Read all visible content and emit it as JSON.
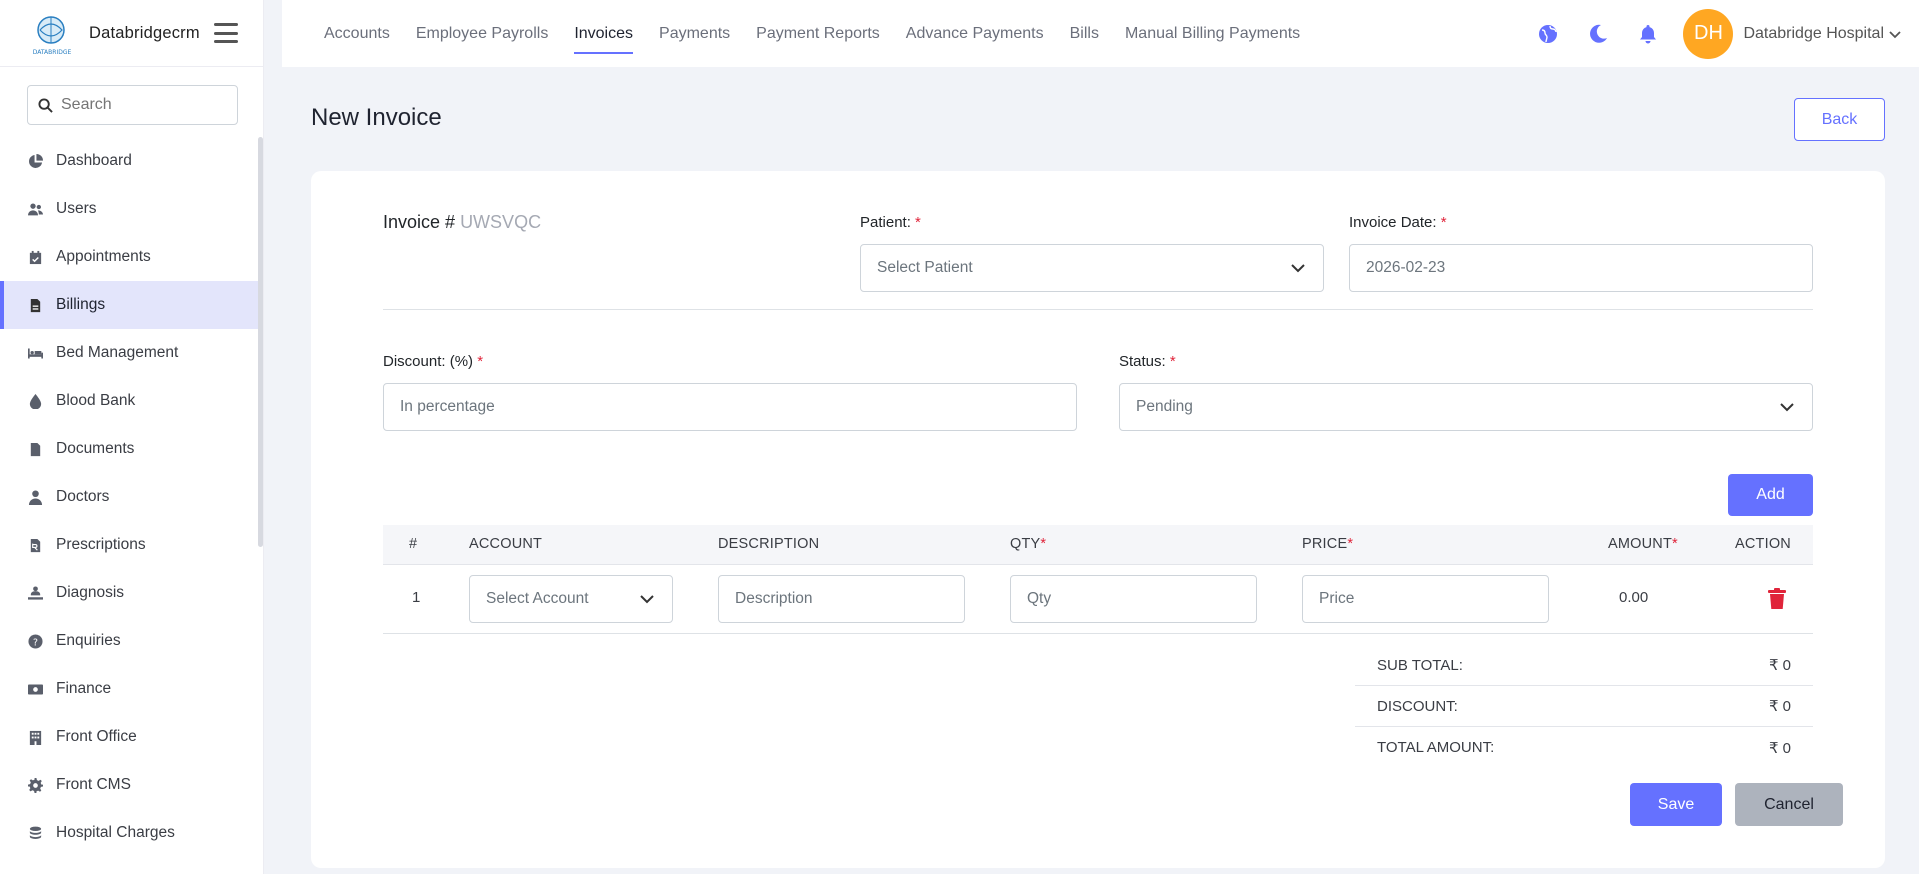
{
  "brand": {
    "name": "Databridgecrm",
    "logo_text": "DATABRIDGE"
  },
  "search": {
    "placeholder": "Search"
  },
  "sidebar": {
    "items": [
      {
        "label": "Dashboard",
        "icon": "pie-chart-icon"
      },
      {
        "label": "Users",
        "icon": "users-icon"
      },
      {
        "label": "Appointments",
        "icon": "calendar-check-icon"
      },
      {
        "label": "Billings",
        "icon": "file-invoice-icon",
        "active": true
      },
      {
        "label": "Bed Management",
        "icon": "bed-icon"
      },
      {
        "label": "Blood Bank",
        "icon": "drop-icon"
      },
      {
        "label": "Documents",
        "icon": "file-icon"
      },
      {
        "label": "Doctors",
        "icon": "doctor-icon"
      },
      {
        "label": "Prescriptions",
        "icon": "prescription-icon"
      },
      {
        "label": "Diagnosis",
        "icon": "diagnosis-icon"
      },
      {
        "label": "Enquiries",
        "icon": "question-circle-icon"
      },
      {
        "label": "Finance",
        "icon": "money-icon"
      },
      {
        "label": "Front Office",
        "icon": "building-icon"
      },
      {
        "label": "Front CMS",
        "icon": "gear-icon"
      },
      {
        "label": "Hospital Charges",
        "icon": "coins-icon"
      }
    ]
  },
  "topnav": {
    "tabs": [
      "Accounts",
      "Employee Payrolls",
      "Invoices",
      "Payments",
      "Payment Reports",
      "Advance Payments",
      "Bills",
      "Manual Billing Payments"
    ],
    "active_tab": "Invoices"
  },
  "user": {
    "initials": "DH",
    "name": "Databridge Hospital"
  },
  "page": {
    "title": "New Invoice",
    "back_label": "Back"
  },
  "form": {
    "invoice_label": "Invoice #",
    "invoice_code": "UWSVQC",
    "patient_label": "Patient:",
    "patient_placeholder": "Select Patient",
    "invoice_date_label": "Invoice Date:",
    "invoice_date_value": "2026-02-23",
    "discount_label": "Discount: (%)",
    "discount_placeholder": "In percentage",
    "status_label": "Status:",
    "status_value": "Pending",
    "required_mark": "*"
  },
  "table": {
    "add_label": "Add",
    "headers": {
      "num": "#",
      "account": "ACCOUNT",
      "description": "DESCRIPTION",
      "qty": "QTY",
      "price": "PRICE",
      "amount": "AMOUNT",
      "action": "ACTION"
    },
    "rows": [
      {
        "num": "1",
        "account_placeholder": "Select Account",
        "description_placeholder": "Description",
        "qty_placeholder": "Qty",
        "price_placeholder": "Price",
        "amount": "0.00"
      }
    ]
  },
  "totals": {
    "sub_total_label": "SUB TOTAL:",
    "sub_total_value": "₹ 0",
    "discount_label": "DISCOUNT:",
    "discount_value": "₹ 0",
    "total_label": "TOTAL AMOUNT:",
    "total_value": "₹ 0"
  },
  "actions": {
    "save_label": "Save",
    "cancel_label": "Cancel"
  },
  "colors": {
    "primary": "#6571ff",
    "danger": "#e0243a",
    "avatar": "#ffa722",
    "secondary": "#adb3bd"
  }
}
